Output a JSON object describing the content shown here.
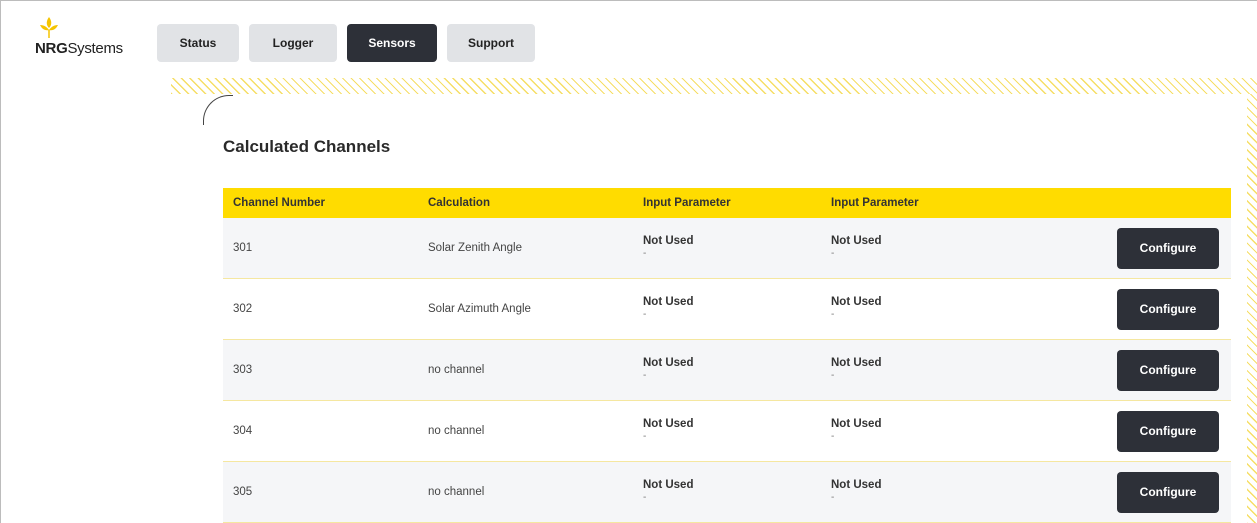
{
  "brand": {
    "bold": "NRG",
    "regular": "Systems",
    "accent_color": "#f5c400"
  },
  "nav": {
    "tabs": [
      {
        "label": "Status",
        "active": false
      },
      {
        "label": "Logger",
        "active": false
      },
      {
        "label": "Sensors",
        "active": true
      },
      {
        "label": "Support",
        "active": false
      }
    ]
  },
  "page": {
    "title": "Calculated Channels"
  },
  "table": {
    "headers": [
      "Channel Number",
      "Calculation",
      "Input Parameter",
      "Input Parameter"
    ],
    "header_color": "#ffdc00",
    "rows": [
      {
        "channel": "301",
        "calculation": "Solar Zenith Angle",
        "param1_title": "Not Used",
        "param1_sub": "-",
        "param2_title": "Not Used",
        "param2_sub": "-",
        "action": "Configure"
      },
      {
        "channel": "302",
        "calculation": "Solar Azimuth Angle",
        "param1_title": "Not Used",
        "param1_sub": "-",
        "param2_title": "Not Used",
        "param2_sub": "-",
        "action": "Configure"
      },
      {
        "channel": "303",
        "calculation": "no channel",
        "param1_title": "Not Used",
        "param1_sub": "-",
        "param2_title": "Not Used",
        "param2_sub": "-",
        "action": "Configure"
      },
      {
        "channel": "304",
        "calculation": "no channel",
        "param1_title": "Not Used",
        "param1_sub": "-",
        "param2_title": "Not Used",
        "param2_sub": "-",
        "action": "Configure"
      },
      {
        "channel": "305",
        "calculation": "no channel",
        "param1_title": "Not Used",
        "param1_sub": "-",
        "param2_title": "Not Used",
        "param2_sub": "-",
        "action": "Configure"
      }
    ]
  },
  "icons": {
    "logo": "sunflower-logo-icon",
    "corner": "corner-arc-decoration"
  }
}
